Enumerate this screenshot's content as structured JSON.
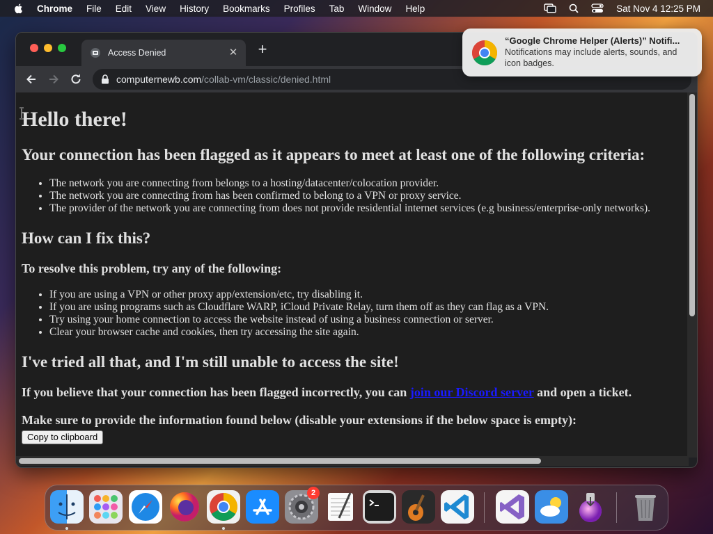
{
  "menubar": {
    "app_name": "Chrome",
    "items": [
      "File",
      "Edit",
      "View",
      "History",
      "Bookmarks",
      "Profiles",
      "Tab",
      "Window",
      "Help"
    ],
    "clock": "Sat Nov 4  12:25 PM"
  },
  "browser": {
    "tab_title": "Access Denied",
    "url_host": "computernewb.com",
    "url_path": "/collab-vm/classic/denied.html"
  },
  "page": {
    "heading": "Hello there!",
    "criteria_heading": "Your connection has been flagged as it appears to meet at least one of the following criteria:",
    "criteria": [
      "The network you are connecting from belongs to a hosting/datacenter/colocation provider.",
      "The network you are connecting from has been confirmed to belong to a VPN or proxy service.",
      "The provider of the network you are connecting from does not provide residential internet services (e.g business/enterprise-only networks)."
    ],
    "fix_heading": "How can I fix this?",
    "resolve_heading": "To resolve this problem, try any of the following:",
    "fixes": [
      "If you are using a VPN or other proxy app/extension/etc, try disabling it.",
      "If you are using programs such as Cloudflare WARP, iCloud Private Relay, turn them off as they can flag as a VPN.",
      "Try using your home connection to access the website instead of using a business connection or server.",
      "Clear your browser cache and cookies, then try accessing the site again."
    ],
    "tried_heading": "I've tried all that, and I'm still unable to access the site!",
    "flag_text_before": "If you believe that your connection has been flagged incorrectly, you can ",
    "discord_link": "join our Discord server",
    "flag_text_after": " and open a ticket.",
    "info_heading": "Make sure to provide the information found below (disable your extensions if the below space is empty):",
    "copy_button": "Copy to clipboard"
  },
  "notification": {
    "title": "“Google Chrome Helper (Alerts)” Notifi...",
    "body": "Notifications may include alerts, sounds, and icon badges."
  },
  "dock": {
    "apps": [
      "finder-icon",
      "launchpad-icon",
      "safari-icon",
      "firefox-icon",
      "chrome-icon",
      "app-store-icon",
      "system-settings-icon",
      "textedit-icon",
      "terminal-icon",
      "garageband-icon",
      "vscode-icon",
      "visual-studio-icon",
      "weather-icon",
      "installer-icon",
      "trash-icon"
    ],
    "settings_badge": "2"
  },
  "colors": {
    "link": "#1a1aff",
    "page_bg": "#1e1e1e",
    "page_text": "#e0e0e0"
  }
}
